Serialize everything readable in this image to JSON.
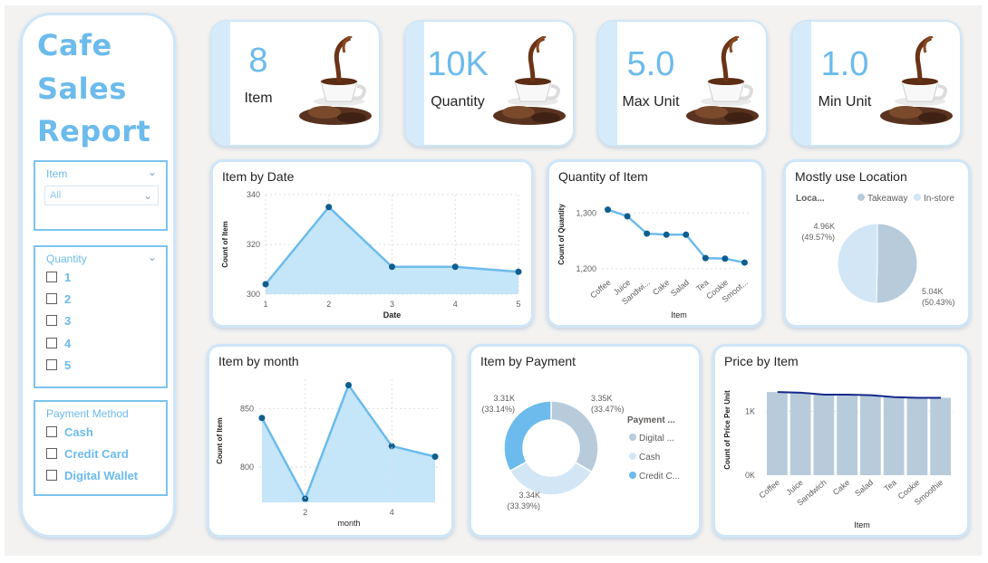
{
  "sidebar": {
    "title_lines": [
      "Cafe",
      "Sales",
      "Report"
    ],
    "item_slicer": {
      "label": "Item",
      "selected": "All"
    },
    "quantity_slicer": {
      "label": "Quantity",
      "options": [
        "1",
        "2",
        "3",
        "4",
        "5"
      ]
    },
    "payment_slicer": {
      "label": "Payment Method",
      "options": [
        "Cash",
        "Credit Card",
        "Digital Wallet"
      ]
    }
  },
  "kpis": [
    {
      "value": "8",
      "label": "Item"
    },
    {
      "value": "10K",
      "label": "Quantity"
    },
    {
      "value": "5.0",
      "label": "Max Unit"
    },
    {
      "value": "1.0",
      "label": "Min Unit"
    }
  ],
  "colors": {
    "accent": "#6cbbec",
    "area": "#bfe2f8",
    "dot": "#0e5e8f",
    "bar": "#b7cbdb",
    "line": "#16288a",
    "slice_light": "#d3e6f5",
    "slice_dark": "#b7cbdb",
    "slice_blue": "#6cbbec"
  },
  "chart_data": [
    {
      "id": "item-by-date",
      "type": "area",
      "title": "Item by Date",
      "xlabel": "Date",
      "ylabel": "Count of Item",
      "x": [
        1,
        2,
        3,
        4,
        5
      ],
      "values": [
        304,
        335,
        311,
        311,
        309
      ],
      "ylim": [
        300,
        340
      ],
      "yticks": [
        "300",
        "320",
        "340"
      ],
      "xticks": [
        "1",
        "2",
        "3",
        "4",
        "5"
      ],
      "grid": true
    },
    {
      "id": "quantity-of-item",
      "type": "line",
      "title": "Quantity of Item",
      "xlabel": "Item",
      "ylabel": "Count of Quantity",
      "categories": [
        "Coffee",
        "Juice",
        "Sandwi...",
        "Cake",
        "Salad",
        "Tea",
        "Cookie",
        "Smoot..."
      ],
      "values": [
        1306,
        1294,
        1263,
        1261,
        1261,
        1219,
        1218,
        1211
      ],
      "ylim": [
        1190,
        1320
      ],
      "yticks": [
        "1,200",
        "1,300"
      ],
      "grid": true
    },
    {
      "id": "mostly-use-location",
      "type": "pie",
      "title": "Mostly use Location",
      "legend_title": "Loca...",
      "legend": [
        "Takeaway",
        "In-store"
      ],
      "slices": [
        {
          "name": "Takeaway",
          "value": 5.04,
          "label": "5.04K",
          "pct": "(50.43%)"
        },
        {
          "name": "In-store",
          "value": 4.96,
          "label": "4.96K",
          "pct": "(49.57%)"
        }
      ]
    },
    {
      "id": "item-by-month",
      "type": "area",
      "title": "Item by month",
      "xlabel": "month",
      "ylabel": "Count of Item",
      "x": [
        1,
        2,
        3,
        4,
        5
      ],
      "values": [
        842,
        773,
        870,
        818,
        809
      ],
      "ylim": [
        770,
        875
      ],
      "yticks": [
        "800",
        "850"
      ],
      "xticks": [
        "2",
        "4"
      ],
      "grid": true
    },
    {
      "id": "item-by-payment",
      "type": "pie",
      "title": "Item by Payment",
      "legend_title": "Payment ...",
      "legend": [
        "Digital ...",
        "Cash",
        "Credit C..."
      ],
      "slices": [
        {
          "name": "Digital Wallet",
          "value": 33.47,
          "label": "3.35K",
          "pct": "(33.47%)"
        },
        {
          "name": "Cash",
          "value": 33.39,
          "label": "3.34K",
          "pct": "(33.39%)"
        },
        {
          "name": "Credit Card",
          "value": 33.14,
          "label": "3.31K",
          "pct": "(33.14%)"
        }
      ]
    },
    {
      "id": "price-by-item",
      "type": "bar",
      "title": "Price by Item",
      "xlabel": "Item",
      "ylabel": "Count of Price Per Unit",
      "categories": [
        "Coffee",
        "Juice",
        "Sandwich",
        "Cake",
        "Salad",
        "Tea",
        "Cookie",
        "Smoothie"
      ],
      "values": [
        1300,
        1290,
        1260,
        1260,
        1250,
        1220,
        1210,
        1210
      ],
      "line_values": [
        1300,
        1290,
        1260,
        1260,
        1250,
        1220,
        1210,
        1210
      ],
      "ylim": [
        0,
        1500
      ],
      "yticks": [
        "0K",
        "1K"
      ]
    }
  ]
}
